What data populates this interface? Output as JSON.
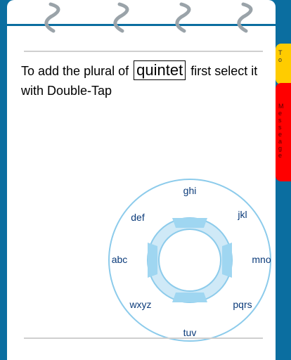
{
  "prompt": {
    "before": "To add the plural of",
    "word": "quintet",
    "after": "first select it with Double-Tap"
  },
  "dial": {
    "labels": [
      "ghi",
      "jkl",
      "mno",
      "pqrs",
      "tuv",
      "wxyz",
      "abc",
      "def"
    ]
  },
  "side_tabs": {
    "yellow_text": "T\no",
    "red_text": "M\ne\ns\ns\ne\na\ng\ne"
  },
  "colors": {
    "frame": "#0b6ea0",
    "dial_ring": "#8ccbeb",
    "dial_text": "#0b3b7a",
    "yellow_tab": "#ffcc00",
    "red_tab": "#ff0000"
  }
}
